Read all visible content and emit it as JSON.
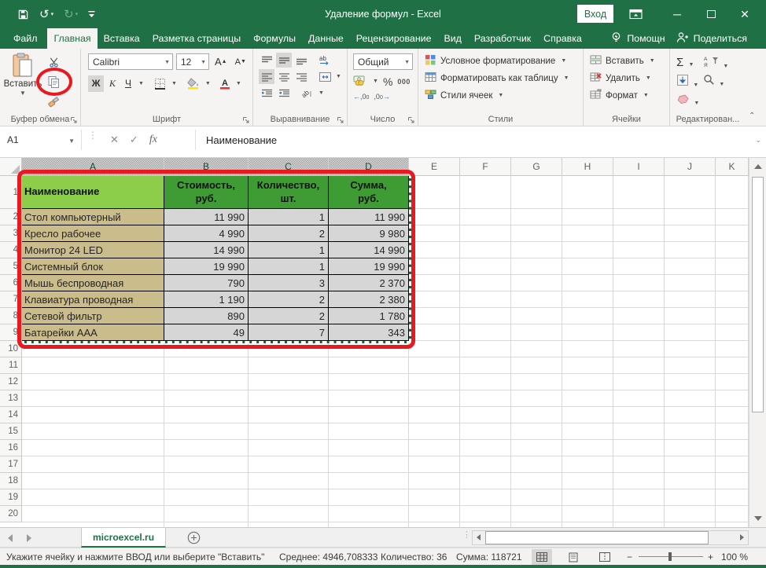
{
  "titlebar": {
    "title": "Удаление формул - Excel",
    "signin": "Вход"
  },
  "tabs": {
    "items": [
      {
        "label": "Файл"
      },
      {
        "label": "Главная",
        "active": true
      },
      {
        "label": "Вставка"
      },
      {
        "label": "Разметка страницы"
      },
      {
        "label": "Формулы"
      },
      {
        "label": "Данные"
      },
      {
        "label": "Рецензирование"
      },
      {
        "label": "Вид"
      },
      {
        "label": "Разработчик"
      },
      {
        "label": "Справка"
      }
    ],
    "help": "Помощн",
    "share": "Поделиться"
  },
  "ribbon": {
    "paste_label": "Вставить",
    "groups": {
      "clipboard": "Буфер обмена",
      "font": "Шрифт",
      "alignment": "Выравнивание",
      "number": "Число",
      "styles": "Стили",
      "cells": "Ячейки",
      "editing": "Редактирован..."
    },
    "font_name": "Calibri",
    "font_size": "12",
    "bold": "Ж",
    "italic": "К",
    "underline": "Ч",
    "number_format": "Общий",
    "percent": "%",
    "thousands": "000",
    "styles_items": [
      "Условное форматирование",
      "Форматировать как таблицу",
      "Стили ячеек"
    ],
    "cells_items": [
      "Вставить",
      "Удалить",
      "Формат"
    ]
  },
  "formula_bar": {
    "name_box": "A1",
    "fx": "fx",
    "value": "Наименование"
  },
  "grid": {
    "columns": [
      "A",
      "B",
      "C",
      "D",
      "E",
      "F",
      "G",
      "H",
      "I",
      "J",
      "K"
    ],
    "selected_columns": 4,
    "row_count": 20,
    "selected_rows": 9
  },
  "table": {
    "headers": [
      "Наименование",
      "Стоимость,\nруб.",
      "Количество,\nшт.",
      "Сумма,\nруб."
    ],
    "rows": [
      {
        "name": "Стол компьютерный",
        "price": "11 990",
        "qty": "1",
        "sum": "11 990"
      },
      {
        "name": "Кресло рабочее",
        "price": "4 990",
        "qty": "2",
        "sum": "9 980"
      },
      {
        "name": "Монитор 24 LED",
        "price": "14 990",
        "qty": "1",
        "sum": "14 990"
      },
      {
        "name": "Системный блок",
        "price": "19 990",
        "qty": "1",
        "sum": "19 990"
      },
      {
        "name": "Мышь беспроводная",
        "price": "790",
        "qty": "3",
        "sum": "2 370"
      },
      {
        "name": "Клавиатура проводная",
        "price": "1 190",
        "qty": "2",
        "sum": "2 380"
      },
      {
        "name": "Сетевой фильтр",
        "price": "890",
        "qty": "2",
        "sum": "1 780"
      },
      {
        "name": "Батарейки AAA",
        "price": "49",
        "qty": "7",
        "sum": "343"
      }
    ]
  },
  "sheet_bar": {
    "tab": "microexcel.ru"
  },
  "status_bar": {
    "hint": "Укажите ячейку и нажмите ВВОД или выберите \"Вставить\"",
    "average": "Среднее: 4946,708333",
    "count": "Количество: 36",
    "sum": "Сумма: 118721",
    "zoom": "100 %"
  },
  "colors": {
    "brand_green": "#1F7145",
    "header_light_green": "#8CCE4A",
    "header_green": "#3F9C35",
    "name_tan": "#CBBC8B",
    "value_gray": "#D6D6D6",
    "annotation_red": "#E8191F"
  },
  "icons": {
    "qat": [
      "save-icon",
      "undo-icon",
      "redo-icon",
      "qat-more-icon"
    ],
    "clipboard": [
      "paste-icon",
      "cut-icon",
      "copy-icon",
      "format-painter-icon"
    ],
    "statusbar_views": [
      "normal-view-icon",
      "page-layout-icon",
      "page-break-icon"
    ]
  }
}
